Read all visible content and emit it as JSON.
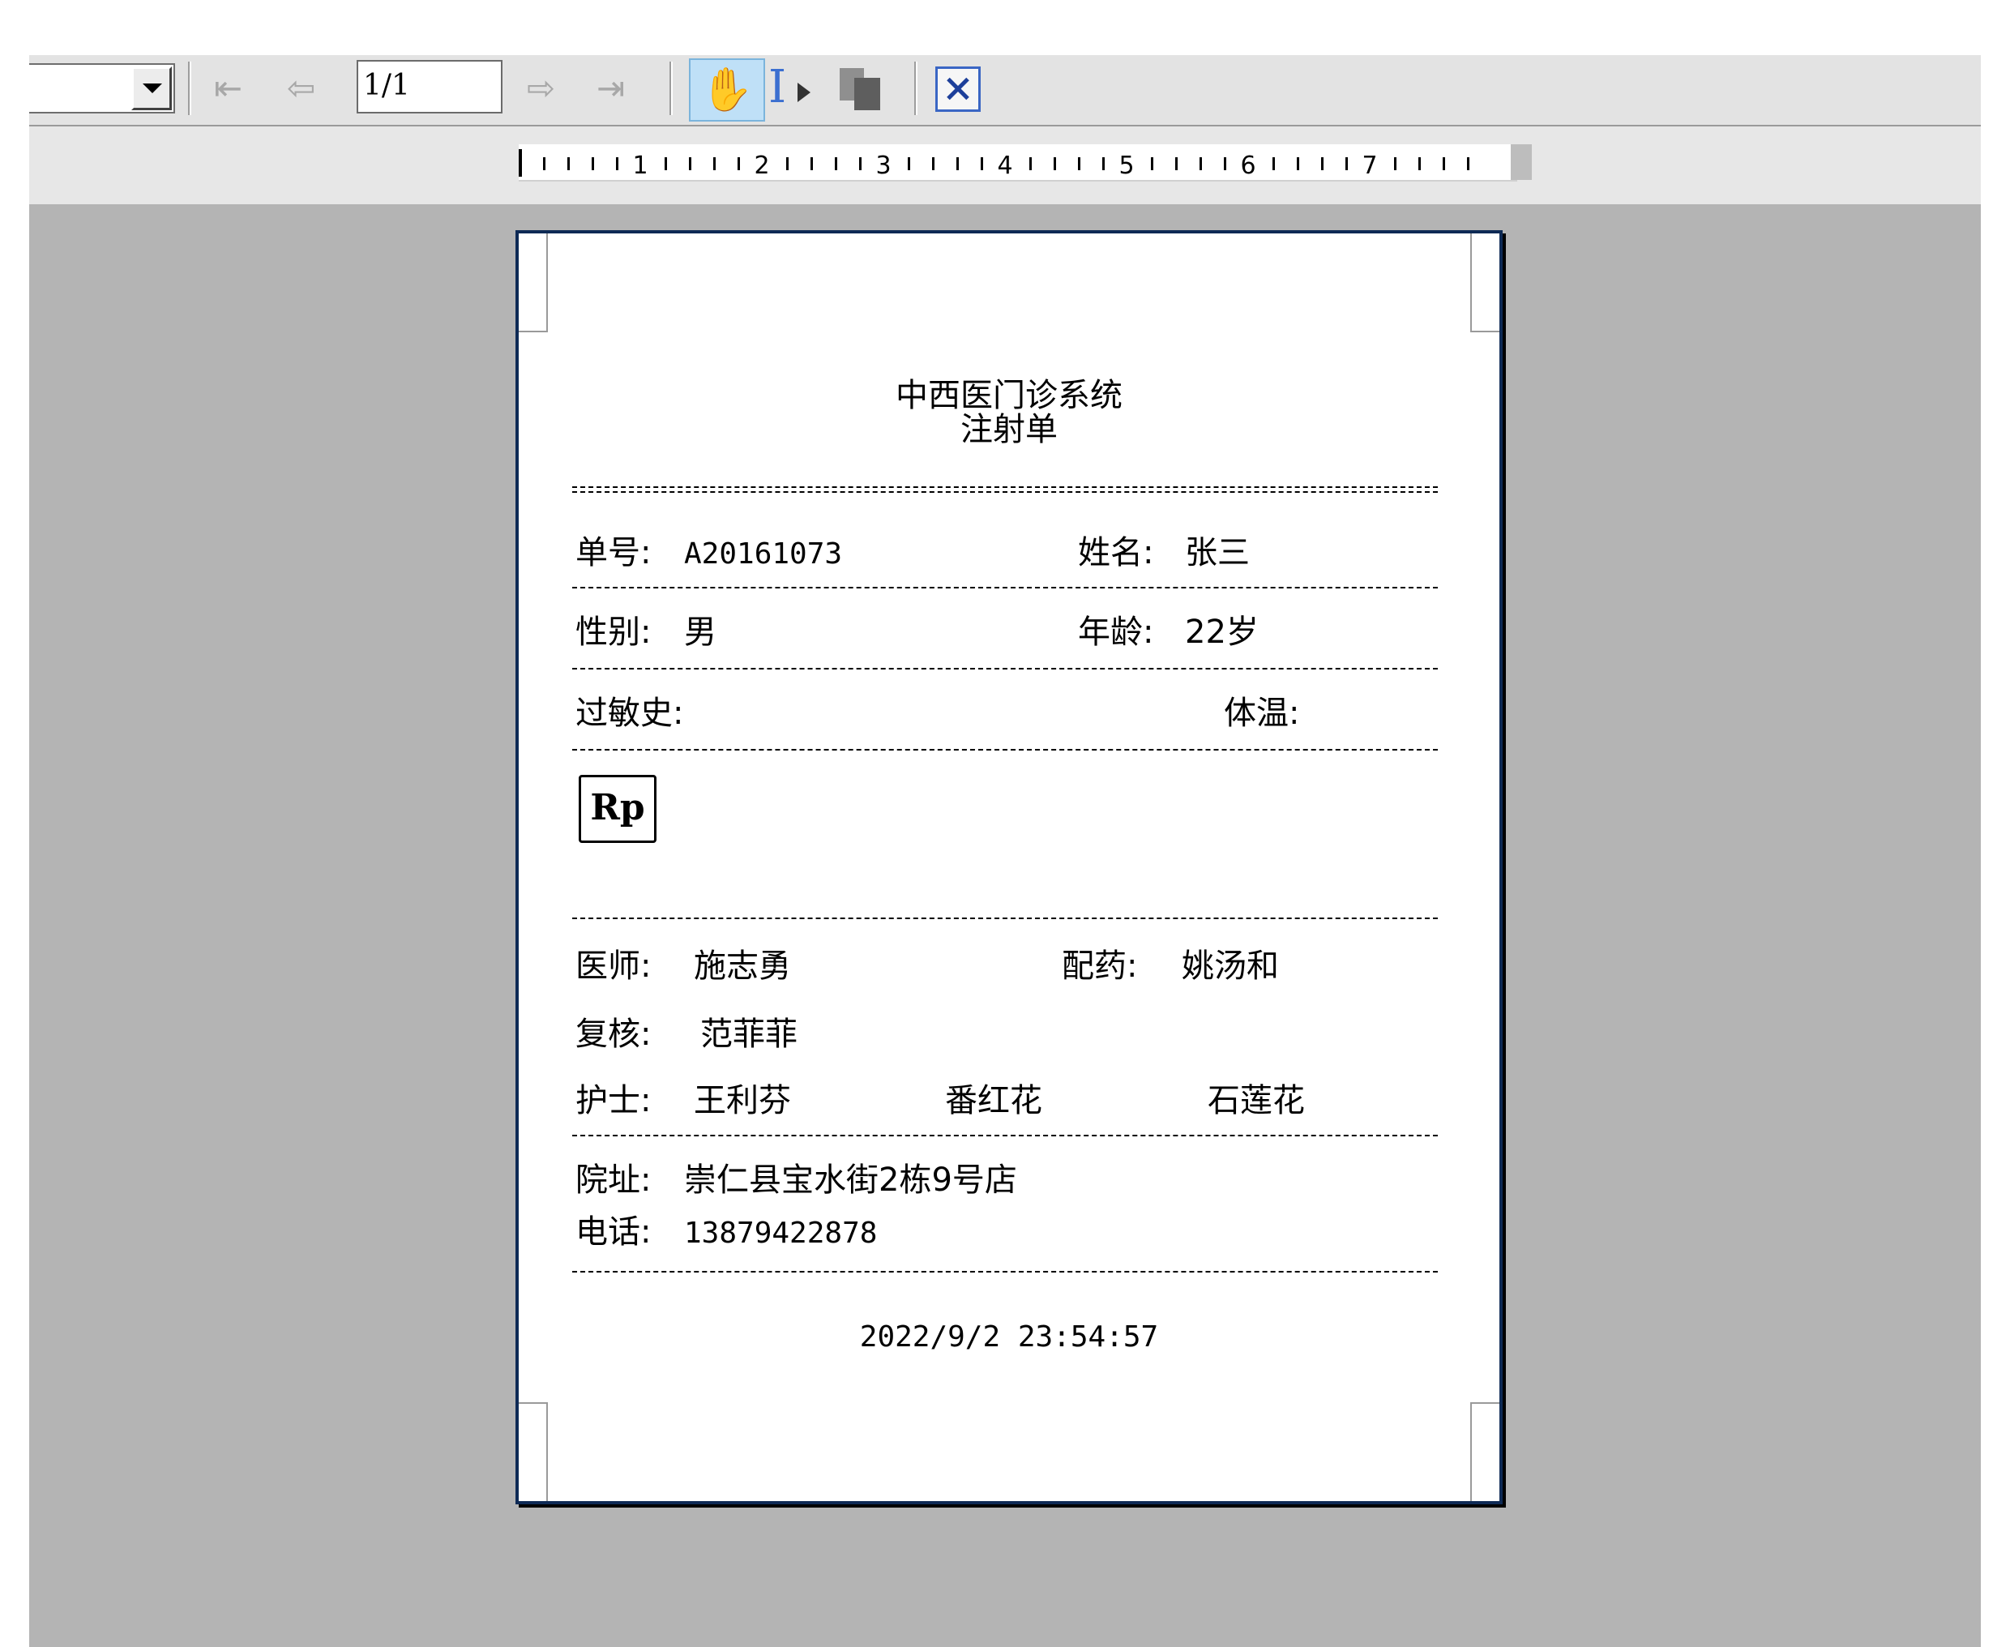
{
  "toolbar": {
    "page_value": "1/1",
    "icons": [
      "dropdown-arrow-icon",
      "first-page-icon",
      "previous-page-icon",
      "next-page-icon",
      "last-page-icon",
      "hand-tool-icon",
      "text-select-icon",
      "copy-icon",
      "close-icon"
    ]
  },
  "ruler": {
    "labels": [
      "1",
      "2",
      "3",
      "4",
      "5",
      "6",
      "7"
    ]
  },
  "document": {
    "title": "中西医门诊系统",
    "subtitle": "注射单",
    "order_label": "单号:",
    "order_value": "A20161073",
    "name_label": "姓名:",
    "name_value": "张三",
    "sex_label": "性别:",
    "sex_value": "男",
    "age_label": "年龄:",
    "age_value": "22岁",
    "allergy_label": "过敏史:",
    "allergy_value": "",
    "temp_label": "体温:",
    "temp_value": "",
    "rp_label": "Rp",
    "doctor_label": "医师:",
    "doctor_value": "施志勇",
    "dispense_label": "配药:",
    "dispense_value": "姚汤和",
    "review_label": "复核:",
    "review_value": "范菲菲",
    "nurse_label": "护士:",
    "nurse_values": [
      "王利芬",
      "番红花",
      "石莲花"
    ],
    "address_label": "院址:",
    "address_value": "崇仁县宝水街2栋9号店",
    "phone_label": "电话:",
    "phone_value": "13879422878",
    "timestamp": "2022/9/2 23:54:57"
  },
  "colors": {
    "canvas": "#b4b4b4",
    "toolbar": "#e3e3e3",
    "active_tool": "#bfe0f7",
    "paper_border": "#0e2a55"
  }
}
